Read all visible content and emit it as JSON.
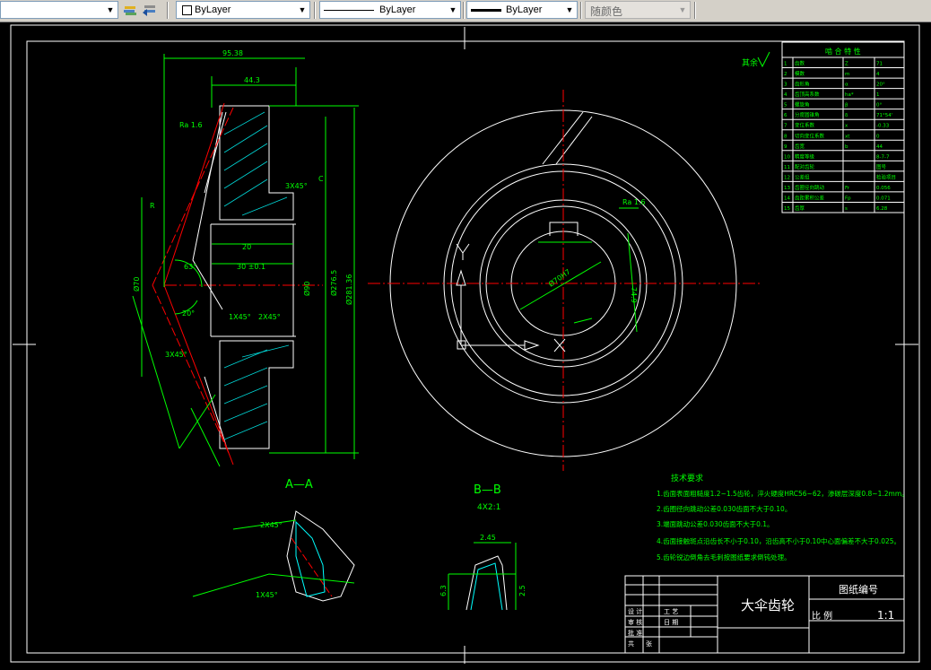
{
  "toolbar": {
    "layer_combo": {
      "value": ""
    },
    "color_combo": {
      "value": "ByLayer"
    },
    "linetype_combo": {
      "value": "ByLayer"
    },
    "lineweight_combo": {
      "value": "ByLayer"
    },
    "plotstyle_combo": {
      "value": "随颜色"
    }
  },
  "drawing": {
    "section_a_label": "A—A",
    "section_b_label": "B—B",
    "section_b_scale": "4X2:1",
    "tech_title": "技术要求",
    "tech_notes": [
      "1.齿面表面粗糙度1.2~1.5齿轮，淬火硬度HRC56~62，渗碳层深度0.8~1.2mm。",
      "2.齿圈径向跳动公差0.030齿面不大于0.10。",
      "3.端面跳动公差0.030齿面不大于0.1。",
      "4.齿面接触斑点沿齿长不小于0.10，沿齿高不小于0.10中心面偏差不大于0.025。",
      "5.齿轮锐边倒角去毛刺按图纸要求倒钝处理。"
    ],
    "part_name": "大伞齿轮",
    "drawing_no_label": "图纸编号",
    "scale_label": "比 例",
    "scale_value": "1:1",
    "title_block_labels": [
      "设 计",
      "审 核",
      "日 期",
      "工 艺",
      "批 准",
      "共",
      "张",
      "第",
      "张"
    ],
    "surface_note": "其余",
    "param_table_title": "啮 合 特 性",
    "dims": {
      "d_outer": "Ø281.36",
      "d_pitch": "Ø276.5",
      "d_bore": "Ø70",
      "d_hub": "Ø90",
      "w_total": "95.38",
      "w_face": "44.3",
      "w_hub": "30 ±0.1",
      "key_w": "20",
      "key_h": "74.9",
      "chamfer1": "1X45°",
      "chamfer2": "2X45°",
      "chamfer3": "3X45°",
      "angle1": "63°",
      "angle2": "20°",
      "bore_tol": "Ø70H7",
      "surface_ra": "Ra 1.6",
      "gear_c": "C",
      "gear_r": "R",
      "b_dim": "2.45",
      "b_dim2": "6.3",
      "b_dim3": "2.5"
    },
    "param_rows": [
      [
        "1",
        "齿数",
        "Z",
        "71"
      ],
      [
        "2",
        "模数",
        "m",
        "4"
      ],
      [
        "3",
        "齿形角",
        "α",
        "20°"
      ],
      [
        "4",
        "齿顶高系数",
        "ha*",
        "1"
      ],
      [
        "5",
        "螺旋角",
        "β",
        "0°"
      ],
      [
        "6",
        "分度圆锥角",
        "δ",
        "71°54'"
      ],
      [
        "7",
        "变位系数",
        "x",
        "-0.33"
      ],
      [
        "8",
        "切向变位系数",
        "xt",
        "0"
      ],
      [
        "9",
        "齿宽",
        "b",
        "44"
      ],
      [
        "10",
        "精度等级",
        "",
        "8-7-7"
      ],
      [
        "11",
        "配对齿轮",
        "",
        "图号"
      ],
      [
        "12",
        "公差组",
        "",
        "检验项目"
      ],
      [
        "13",
        "齿圈径向跳动",
        "Fr",
        "0.056"
      ],
      [
        "14",
        "齿距累积公差",
        "Fp",
        "0.071"
      ],
      [
        "15",
        "齿厚",
        "s",
        "6.28"
      ]
    ]
  }
}
